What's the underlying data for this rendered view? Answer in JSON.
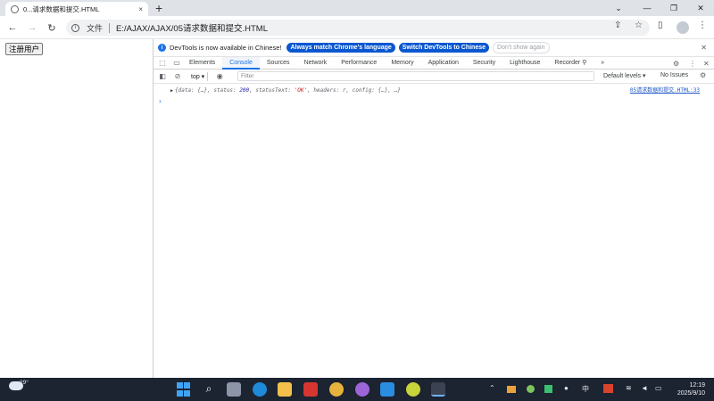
{
  "browser": {
    "tab_title": "0...请求数据和提交.HTML",
    "tab_close": "×",
    "new_tab": "+",
    "window_controls": {
      "tab_search": "⌄",
      "minimize": "—",
      "restore": "❐",
      "close": "✕"
    },
    "address_chip": "文件",
    "url": "E:/AJAX/AJAX/05请求数据和提交.HTML"
  },
  "page": {
    "register_button": "注册用户"
  },
  "devtools": {
    "infobar": {
      "message": "DevTools is now available in Chinese!",
      "btn_match": "Always match Chrome's language",
      "btn_switch": "Switch DevTools to Chinese",
      "btn_dont_show": "Don't show again",
      "close": "✕"
    },
    "tabs": [
      "Elements",
      "Console",
      "Sources",
      "Network",
      "Performance",
      "Memory",
      "Application",
      "Security",
      "Lighthouse",
      "Recorder ⚲"
    ],
    "more_tabs": "»",
    "console_toolbar": {
      "context": "top ▾",
      "filter_placeholder": "Filter",
      "levels": "Default levels ▾",
      "issues": "No Issues"
    },
    "log": {
      "p_open": "{data: ",
      "p_data": "{…}",
      "p_status_key": ", status: ",
      "status": "200",
      "p_statustext_key": ", statusText: ",
      "statusText": "'OK'",
      "p_rest": ", headers: r, config: {…}, …}",
      "source": "05请求数据和提交.HTML:33"
    },
    "prompt": "›"
  },
  "taskbar": {
    "temperature": "29°",
    "time": "12:19",
    "date": "2025/9/10",
    "ime": "中"
  },
  "colors": {
    "accent": "#1a73e8",
    "taskbar_bg": "#1c2331",
    "tabstrip_bg": "#dfe3e8"
  }
}
